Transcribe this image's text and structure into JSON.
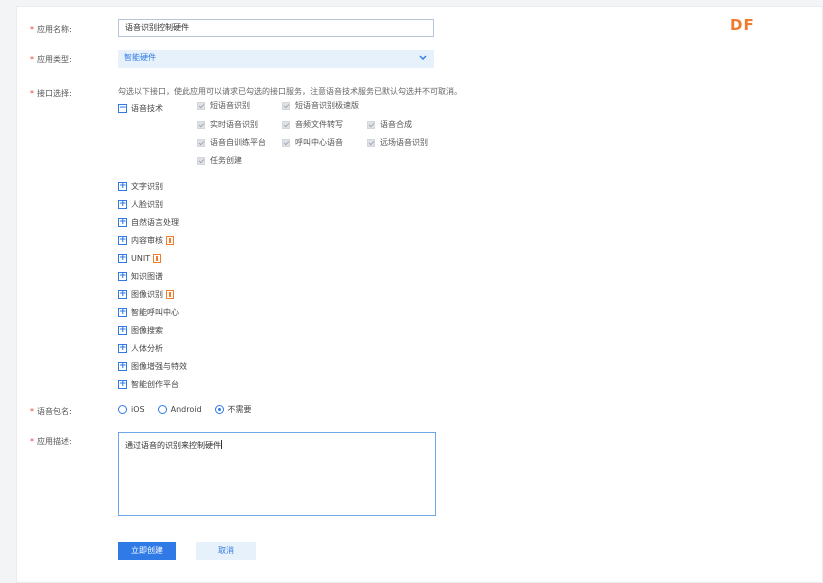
{
  "watermark": "DF",
  "required_mark": "*",
  "form": {
    "app_name": {
      "label": "应用名称:",
      "value": "语音识别控制硬件"
    },
    "app_type": {
      "label": "应用类型:",
      "value": "智能硬件"
    },
    "interfaces": {
      "label": "接口选择:",
      "hint": "勾选以下接口，使此应用可以请求已勾选的接口服务，注意语音技术服务已默认勾选并不可取消。",
      "groups": [
        {
          "label": "语音技术",
          "expanded": true,
          "badge": false
        },
        {
          "label": "文字识别",
          "expanded": false,
          "badge": false
        },
        {
          "label": "人脸识别",
          "expanded": false,
          "badge": false
        },
        {
          "label": "自然语言处理",
          "expanded": false,
          "badge": false
        },
        {
          "label": "内容审核",
          "expanded": false,
          "badge": true
        },
        {
          "label": "UNIT",
          "expanded": false,
          "badge": true
        },
        {
          "label": "知识图谱",
          "expanded": false,
          "badge": false
        },
        {
          "label": "图像识别",
          "expanded": false,
          "badge": true
        },
        {
          "label": "智能呼叫中心",
          "expanded": false,
          "badge": false
        },
        {
          "label": "图像搜索",
          "expanded": false,
          "badge": false
        },
        {
          "label": "人体分析",
          "expanded": false,
          "badge": false
        },
        {
          "label": "图像增强与特效",
          "expanded": false,
          "badge": false
        },
        {
          "label": "智能创作平台",
          "expanded": false,
          "badge": false
        }
      ],
      "speech_items": [
        {
          "label": "短语音识别",
          "checked": true
        },
        {
          "label": "短语音识别极速版",
          "checked": true
        },
        {
          "label": "实时语音识别",
          "checked": true
        },
        {
          "label": "音频文件转写",
          "checked": true
        },
        {
          "label": "语音合成",
          "checked": true
        },
        {
          "label": "语音自训练平台",
          "checked": true
        },
        {
          "label": "呼叫中心语音",
          "checked": true
        },
        {
          "label": "远场语音识别",
          "checked": true
        },
        {
          "label": "任务创建",
          "checked": true
        }
      ]
    },
    "package": {
      "label": "语音包名:",
      "options": [
        {
          "label": "iOS",
          "selected": false
        },
        {
          "label": "Android",
          "selected": false
        },
        {
          "label": "不需要",
          "selected": true
        }
      ]
    },
    "description": {
      "label": "应用描述:",
      "value": "通过语音的识别来控制硬件"
    },
    "submit_label": "立即创建",
    "cancel_label": "取消"
  }
}
